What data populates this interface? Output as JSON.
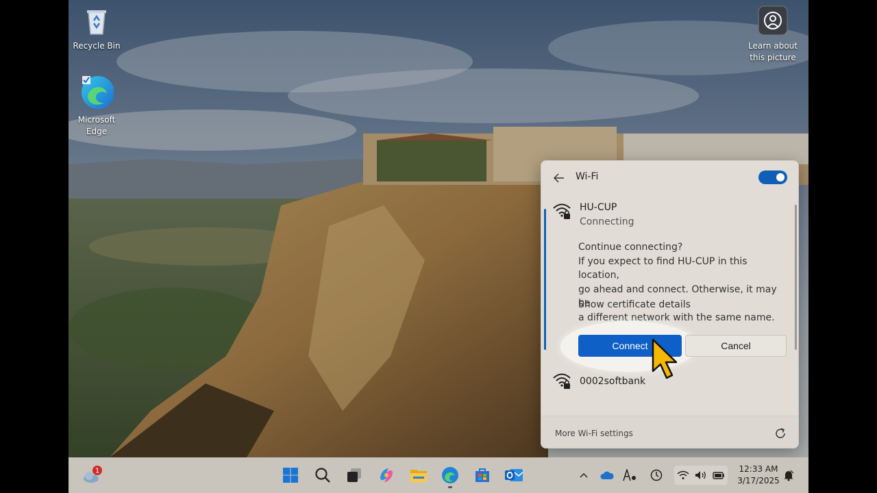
{
  "desktop": {
    "icons": [
      {
        "label_lines": [
          "Recycle Bin"
        ],
        "icon": "recycle-bin-icon"
      },
      {
        "label_lines": [
          "Microsoft",
          "Edge"
        ],
        "icon": "edge-icon"
      },
      {
        "label_lines": [
          "Learn about",
          "this picture"
        ],
        "icon": "learn-about-picture-icon"
      }
    ]
  },
  "wifi_flyout": {
    "title": "Wi-Fi",
    "toggle_on": true,
    "networks": [
      {
        "name": "HU-CUP",
        "status": "Connecting",
        "prompt_lines": [
          "Continue connecting?",
          "If you expect to find HU-CUP in this location,",
          "go ahead and connect. Otherwise, it may be",
          "a different network with the same name."
        ],
        "certificate_link": "Show certificate details",
        "connect_label": "Connect",
        "cancel_label": "Cancel"
      },
      {
        "name": "0002softbank"
      }
    ],
    "footer_link": "More Wi-Fi settings"
  },
  "taskbar": {
    "notification_badge": "1",
    "apps": [
      "start-icon",
      "search-icon",
      "task-view-icon",
      "copilot-icon",
      "file-explorer-icon",
      "edge-icon",
      "store-icon",
      "outlook-icon"
    ],
    "tray": [
      "chevron-up-icon",
      "onedrive-icon",
      "pen-icon",
      "clock-app-icon",
      "wifi-icon",
      "volume-icon",
      "battery-icon"
    ],
    "time": "12:33 AM",
    "date": "3/17/2025"
  },
  "colors": {
    "accent": "#0e5fc6",
    "toggle": "#0f5fb8"
  }
}
